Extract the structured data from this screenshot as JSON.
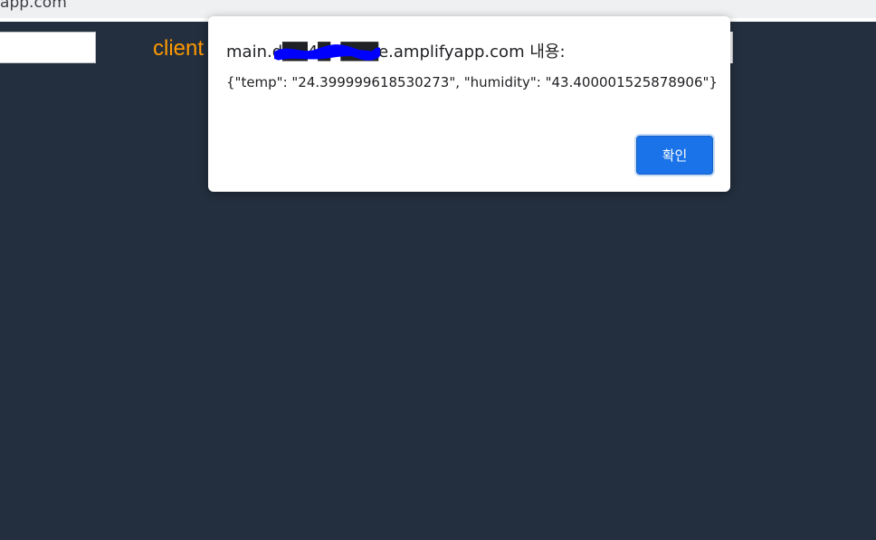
{
  "browser": {
    "url_fragment": "yapp.com"
  },
  "app": {
    "title": "client"
  },
  "dialog": {
    "title_prefix": "main.",
    "title_redacted": "d██4█7███",
    "title_suffix": "e.amplifyapp.com 내용:",
    "message": "{\"temp\": \"24.399999618530273\", \"humidity\": \"43.400001525878906\"}",
    "ok_label": "확인"
  },
  "colors": {
    "page_background": "#232f3e",
    "title_accent": "#ff9900",
    "button_primary": "#1a73e8",
    "redaction": "#0000ff"
  }
}
